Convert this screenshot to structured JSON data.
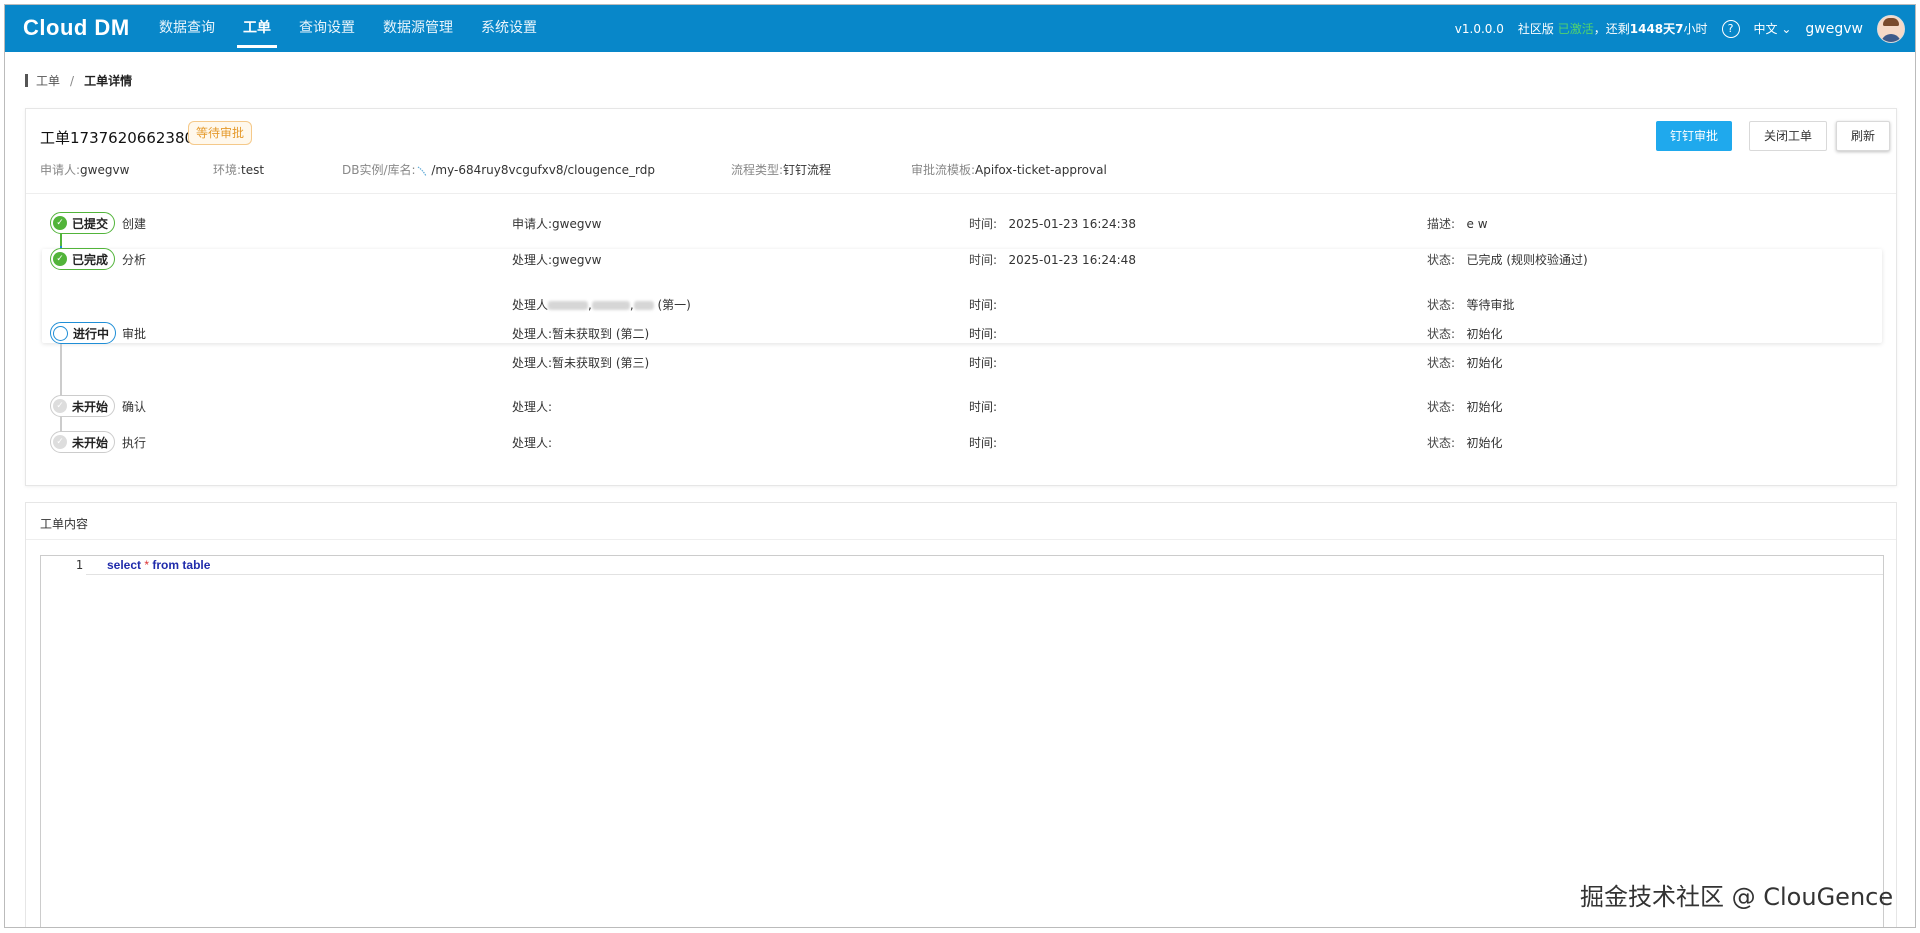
{
  "header": {
    "logo": "Cloud DM",
    "nav": [
      "数据查询",
      "工单",
      "查询设置",
      "数据源管理",
      "系统设置"
    ],
    "version": "v1.0.0.0",
    "edition": "社区版",
    "activated": "已激活",
    "remaining_prefix": "，还剩",
    "remaining_value": "1448天7",
    "remaining_suffix": "小时",
    "help_symbol": "?",
    "language": "中文",
    "username": "gwegvw",
    "icons": {
      "help": "help-icon",
      "language_caret": "chevron-down-icon",
      "avatar": "avatar"
    }
  },
  "breadcrumb": {
    "root": "工单",
    "separator": "/",
    "current": "工单详情"
  },
  "ticket": {
    "title": "工单1737620662380",
    "status": "等待审批",
    "status_color": "#e59a2c",
    "buttons": {
      "dingtalk": "钉钉审批",
      "close": "关闭工单",
      "refresh": "刷新"
    },
    "meta": {
      "applicant_label": "申请人:",
      "applicant": "gwegvw",
      "env_label": "环境:",
      "env": "test",
      "db_label": "DB实例/库名:",
      "db": "/my-684ruy8vcgufxv8/clougence_rdp",
      "flow_label": "流程类型:",
      "flow": "钉钉流程",
      "template_label": "审批流模板:",
      "template": "Apifox-ticket-approval"
    }
  },
  "steps": [
    {
      "badge": "已提交",
      "name": "创建",
      "c1": "申请人:gwegvw",
      "c2_label": "时间:",
      "c2": "2025-01-23 16:24:38",
      "c3_label": "描述:",
      "c3": "e w"
    },
    {
      "badge": "已完成",
      "name": "分析",
      "c1": "处理人:gwegvw",
      "c2_label": "时间:",
      "c2": "2025-01-23 16:24:48",
      "c3_label": "状态:",
      "c3": "已完成 (规则校验通过)"
    },
    {
      "badge": "进行中",
      "name": "审批",
      "rows": [
        {
          "c1_prefix": "处理人",
          "c1_suffix": "(第一)",
          "c2_label": "时间:",
          "c3_label": "状态:",
          "c3": "等待审批"
        },
        {
          "c1": "处理人:暂未获取到 (第二)",
          "c2_label": "时间:",
          "c3_label": "状态:",
          "c3": "初始化"
        },
        {
          "c1": "处理人:暂未获取到 (第三)",
          "c2_label": "时间:",
          "c3_label": "状态:",
          "c3": "初始化"
        }
      ]
    },
    {
      "badge": "未开始",
      "name": "确认",
      "c1": "处理人:",
      "c2_label": "时间:",
      "c3_label": "状态:",
      "c3": "初始化"
    },
    {
      "badge": "未开始",
      "name": "执行",
      "c1": "处理人:",
      "c2_label": "时间:",
      "c3_label": "状态:",
      "c3": "初始化"
    }
  ],
  "content": {
    "title": "工单内容",
    "line_number": "1",
    "code_kw1": "select",
    "code_op": "*",
    "code_kw2": "from",
    "code_kw3": "table"
  },
  "watermark": "掘金技术社区 @ ClouGence",
  "colors": {
    "header_bg": "#0887c9",
    "primary_button": "#1fa9ed",
    "done_green": "#52b43a",
    "active_blue": "#1f8ed6"
  }
}
